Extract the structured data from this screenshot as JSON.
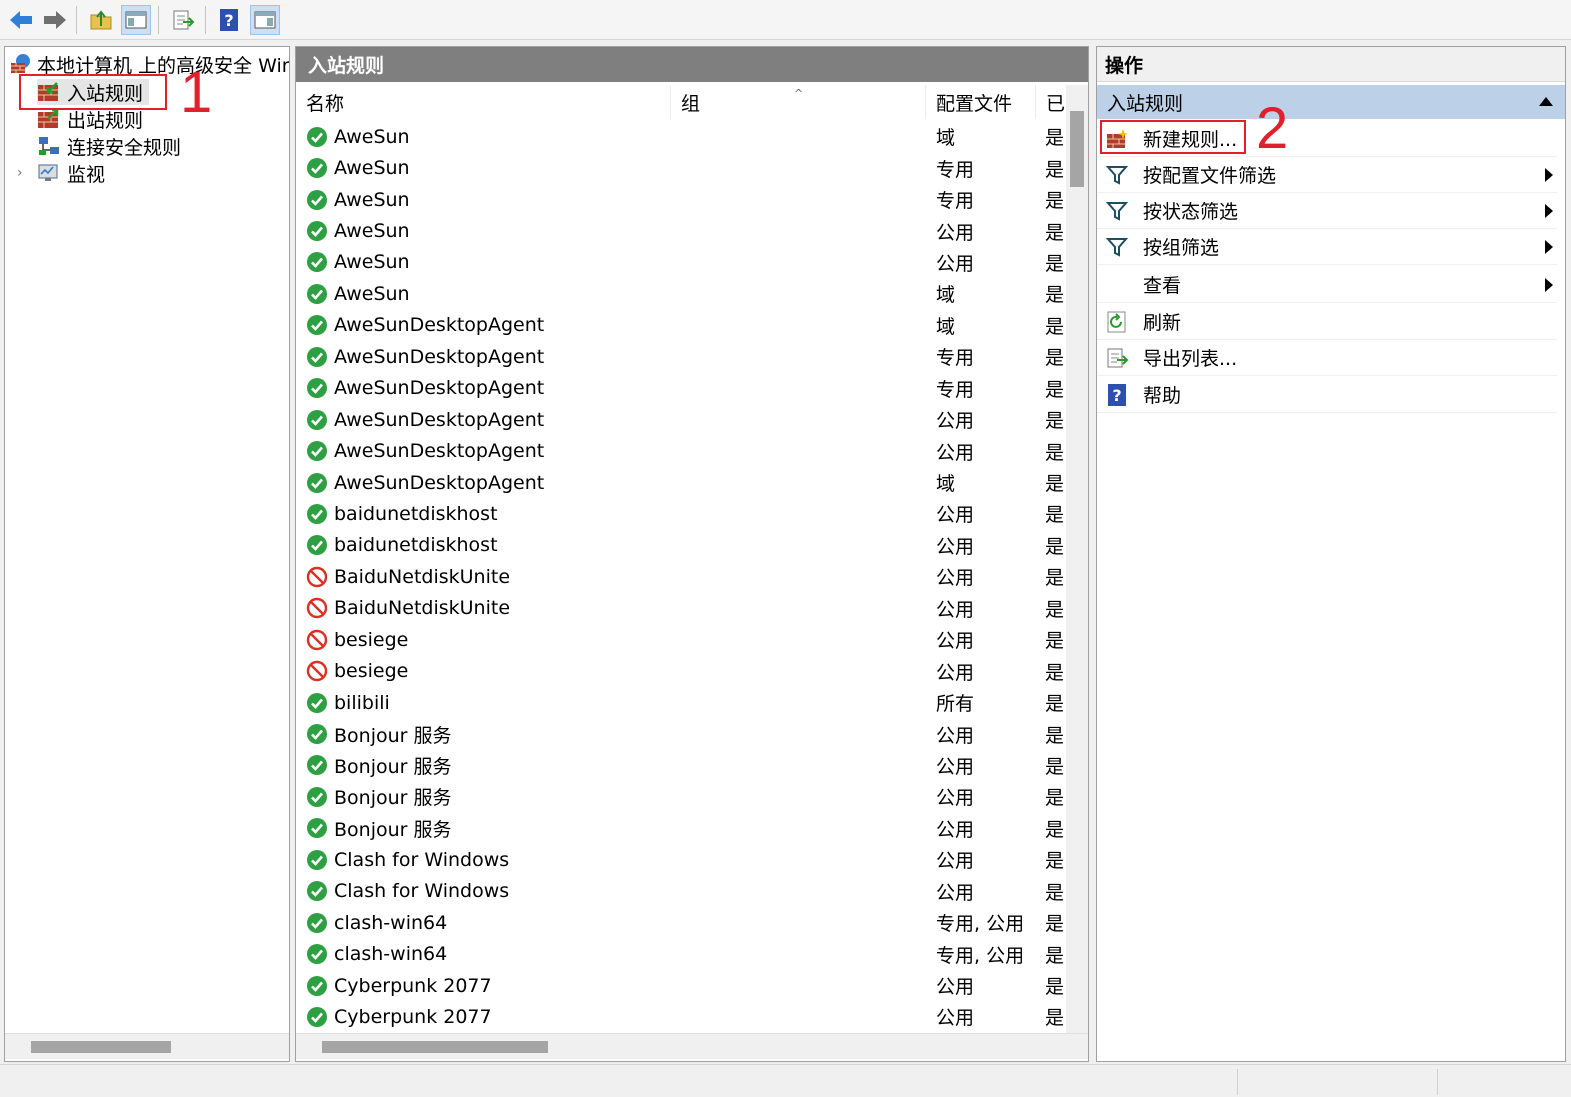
{
  "toolbar": {
    "buttons": [
      "back-icon",
      "forward-icon",
      "up-folder-icon",
      "show-hide-tree-icon",
      "export-list-icon",
      "help-icon",
      "show-hide-action-pane-icon"
    ]
  },
  "tree": {
    "root_label": "本地计算机 上的高级安全 Winc",
    "items": [
      {
        "label": "入站规则",
        "selected": true
      },
      {
        "label": "出站规则"
      },
      {
        "label": "连接安全规则"
      },
      {
        "label": "监视"
      }
    ]
  },
  "middle": {
    "title": "入站规则",
    "columns": {
      "name": "名称",
      "group": "组",
      "profile": "配置文件",
      "enabled": "已"
    },
    "rows": [
      {
        "name": "AweSun",
        "profile": "域",
        "enabled": "是",
        "status": "allow"
      },
      {
        "name": "AweSun",
        "profile": "专用",
        "enabled": "是",
        "status": "allow"
      },
      {
        "name": "AweSun",
        "profile": "专用",
        "enabled": "是",
        "status": "allow"
      },
      {
        "name": "AweSun",
        "profile": "公用",
        "enabled": "是",
        "status": "allow"
      },
      {
        "name": "AweSun",
        "profile": "公用",
        "enabled": "是",
        "status": "allow"
      },
      {
        "name": "AweSun",
        "profile": "域",
        "enabled": "是",
        "status": "allow"
      },
      {
        "name": "AweSunDesktopAgent",
        "profile": "域",
        "enabled": "是",
        "status": "allow"
      },
      {
        "name": "AweSunDesktopAgent",
        "profile": "专用",
        "enabled": "是",
        "status": "allow"
      },
      {
        "name": "AweSunDesktopAgent",
        "profile": "专用",
        "enabled": "是",
        "status": "allow"
      },
      {
        "name": "AweSunDesktopAgent",
        "profile": "公用",
        "enabled": "是",
        "status": "allow"
      },
      {
        "name": "AweSunDesktopAgent",
        "profile": "公用",
        "enabled": "是",
        "status": "allow"
      },
      {
        "name": "AweSunDesktopAgent",
        "profile": "域",
        "enabled": "是",
        "status": "allow"
      },
      {
        "name": "baidunetdiskhost",
        "profile": "公用",
        "enabled": "是",
        "status": "allow"
      },
      {
        "name": "baidunetdiskhost",
        "profile": "公用",
        "enabled": "是",
        "status": "allow"
      },
      {
        "name": "BaiduNetdiskUnite",
        "profile": "公用",
        "enabled": "是",
        "status": "block"
      },
      {
        "name": "BaiduNetdiskUnite",
        "profile": "公用",
        "enabled": "是",
        "status": "block"
      },
      {
        "name": "besiege",
        "profile": "公用",
        "enabled": "是",
        "status": "block"
      },
      {
        "name": "besiege",
        "profile": "公用",
        "enabled": "是",
        "status": "block"
      },
      {
        "name": "bilibili",
        "profile": "所有",
        "enabled": "是",
        "status": "allow"
      },
      {
        "name": "Bonjour 服务",
        "profile": "公用",
        "enabled": "是",
        "status": "allow"
      },
      {
        "name": "Bonjour 服务",
        "profile": "公用",
        "enabled": "是",
        "status": "allow"
      },
      {
        "name": "Bonjour 服务",
        "profile": "公用",
        "enabled": "是",
        "status": "allow"
      },
      {
        "name": "Bonjour 服务",
        "profile": "公用",
        "enabled": "是",
        "status": "allow"
      },
      {
        "name": "Clash for Windows",
        "profile": "公用",
        "enabled": "是",
        "status": "allow"
      },
      {
        "name": "Clash for Windows",
        "profile": "公用",
        "enabled": "是",
        "status": "allow"
      },
      {
        "name": "clash-win64",
        "profile": "专用, 公用",
        "enabled": "是",
        "status": "allow"
      },
      {
        "name": "clash-win64",
        "profile": "专用, 公用",
        "enabled": "是",
        "status": "allow"
      },
      {
        "name": "Cyberpunk 2077",
        "profile": "公用",
        "enabled": "是",
        "status": "allow"
      },
      {
        "name": "Cyberpunk 2077",
        "profile": "公用",
        "enabled": "是",
        "status": "allow"
      }
    ]
  },
  "actions": {
    "title": "操作",
    "group": "入站规则",
    "items": [
      {
        "label": "新建规则...",
        "icon": "new-rule-icon",
        "submenu": false
      },
      {
        "label": "按配置文件筛选",
        "icon": "filter-icon",
        "submenu": true
      },
      {
        "label": "按状态筛选",
        "icon": "filter-icon",
        "submenu": true
      },
      {
        "label": "按组筛选",
        "icon": "filter-icon",
        "submenu": true
      },
      {
        "label": "查看",
        "icon": "",
        "submenu": true
      },
      {
        "label": "刷新",
        "icon": "refresh-icon",
        "submenu": false
      },
      {
        "label": "导出列表...",
        "icon": "export-list-icon",
        "submenu": false
      },
      {
        "label": "帮助",
        "icon": "help-icon",
        "submenu": false
      }
    ]
  },
  "annotations": {
    "step1": "1",
    "step2": "2",
    "color": "#e0202a"
  },
  "colors": {
    "allow": "#2ea043",
    "block": "#d93025",
    "header_bg": "#7f7f7f",
    "action_group_bg": "#bcd0e8"
  }
}
